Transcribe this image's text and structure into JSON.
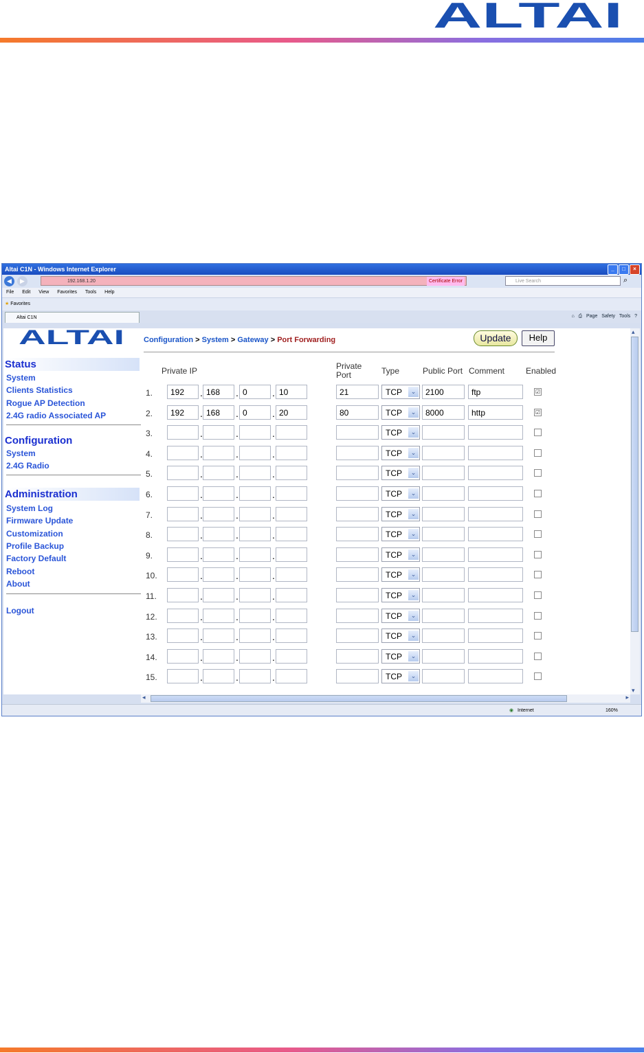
{
  "doc": {
    "logo_text": "ALTAI",
    "colors": {
      "brand_blue": "#1a4fb0",
      "bar_start": "#f57a2a",
      "bar_end": "#4a7fe8"
    }
  },
  "browser": {
    "title": "Altai C1N - Windows Internet Explorer",
    "address": "192.168.1.20",
    "cert_error": "Certificate Error",
    "search_placeholder": "Live Search",
    "menu": [
      "File",
      "Edit",
      "View",
      "Favorites",
      "Tools",
      "Help"
    ],
    "favorites": "Favorites",
    "tab_label": "Altai C1N",
    "toolbar_page": "Page",
    "toolbar_safety": "Safety",
    "toolbar_tools": "Tools",
    "status_zone": "Internet",
    "zoom": "160%"
  },
  "site": {
    "logo_text": "ALTAI"
  },
  "sidebar": {
    "status": {
      "title": "Status",
      "items": [
        "System",
        "Clients Statistics",
        "Rogue AP Detection",
        "2.4G radio Associated AP"
      ]
    },
    "configuration": {
      "title": "Configuration",
      "items": [
        "System",
        "2.4G Radio"
      ]
    },
    "administration": {
      "title": "Administration",
      "items": [
        "System Log",
        "Firmware Update",
        "Customization",
        "Profile Backup",
        "Factory Default",
        "Reboot",
        "About"
      ]
    },
    "logout": "Logout"
  },
  "breadcrumb": {
    "items": [
      "Configuration",
      "System",
      "Gateway"
    ],
    "current": "Port Forwarding",
    "sep": ">"
  },
  "buttons": {
    "update": "Update",
    "help": "Help"
  },
  "table": {
    "headers": {
      "private_ip": "Private IP",
      "private_port_1": "Private",
      "private_port_2": "Port",
      "type": "Type",
      "public_port": "Public Port",
      "comment": "Comment",
      "enabled": "Enabled"
    },
    "rows": [
      {
        "num": "1.",
        "ip": [
          "192",
          "168",
          "0",
          "10"
        ],
        "private_port": "21",
        "type": "TCP",
        "public_port": "2100",
        "comment": "ftp",
        "enabled": "☑"
      },
      {
        "num": "2.",
        "ip": [
          "192",
          "168",
          "0",
          "20"
        ],
        "private_port": "80",
        "type": "TCP",
        "public_port": "8000",
        "comment": "http",
        "enabled": "☑"
      },
      {
        "num": "3.",
        "ip": [
          "",
          "",
          "",
          ""
        ],
        "private_port": "",
        "type": "TCP",
        "public_port": "",
        "comment": "",
        "enabled": ""
      },
      {
        "num": "4.",
        "ip": [
          "",
          "",
          "",
          ""
        ],
        "private_port": "",
        "type": "TCP",
        "public_port": "",
        "comment": "",
        "enabled": ""
      },
      {
        "num": "5.",
        "ip": [
          "",
          "",
          "",
          ""
        ],
        "private_port": "",
        "type": "TCP",
        "public_port": "",
        "comment": "",
        "enabled": ""
      },
      {
        "num": "6.",
        "ip": [
          "",
          "",
          "",
          ""
        ],
        "private_port": "",
        "type": "TCP",
        "public_port": "",
        "comment": "",
        "enabled": ""
      },
      {
        "num": "7.",
        "ip": [
          "",
          "",
          "",
          ""
        ],
        "private_port": "",
        "type": "TCP",
        "public_port": "",
        "comment": "",
        "enabled": ""
      },
      {
        "num": "8.",
        "ip": [
          "",
          "",
          "",
          ""
        ],
        "private_port": "",
        "type": "TCP",
        "public_port": "",
        "comment": "",
        "enabled": ""
      },
      {
        "num": "9.",
        "ip": [
          "",
          "",
          "",
          ""
        ],
        "private_port": "",
        "type": "TCP",
        "public_port": "",
        "comment": "",
        "enabled": ""
      },
      {
        "num": "10.",
        "ip": [
          "",
          "",
          "",
          ""
        ],
        "private_port": "",
        "type": "TCP",
        "public_port": "",
        "comment": "",
        "enabled": ""
      },
      {
        "num": "11.",
        "ip": [
          "",
          "",
          "",
          ""
        ],
        "private_port": "",
        "type": "TCP",
        "public_port": "",
        "comment": "",
        "enabled": ""
      },
      {
        "num": "12.",
        "ip": [
          "",
          "",
          "",
          ""
        ],
        "private_port": "",
        "type": "TCP",
        "public_port": "",
        "comment": "",
        "enabled": ""
      },
      {
        "num": "13.",
        "ip": [
          "",
          "",
          "",
          ""
        ],
        "private_port": "",
        "type": "TCP",
        "public_port": "",
        "comment": "",
        "enabled": ""
      },
      {
        "num": "14.",
        "ip": [
          "",
          "",
          "",
          ""
        ],
        "private_port": "",
        "type": "TCP",
        "public_port": "",
        "comment": "",
        "enabled": ""
      },
      {
        "num": "15.",
        "ip": [
          "",
          "",
          "",
          ""
        ],
        "private_port": "",
        "type": "TCP",
        "public_port": "",
        "comment": "",
        "enabled": ""
      }
    ]
  },
  "icons": {
    "back": "◀",
    "forward": "▶",
    "dropdown": "⌄",
    "search": "⌕",
    "minimize": "_",
    "maximize": "□",
    "close": "×",
    "star": "★",
    "home": "⌂",
    "print": "⎙",
    "help": "?",
    "up": "▴",
    "down": "▾",
    "left": "◂",
    "right": "▸",
    "globe": "◉"
  }
}
